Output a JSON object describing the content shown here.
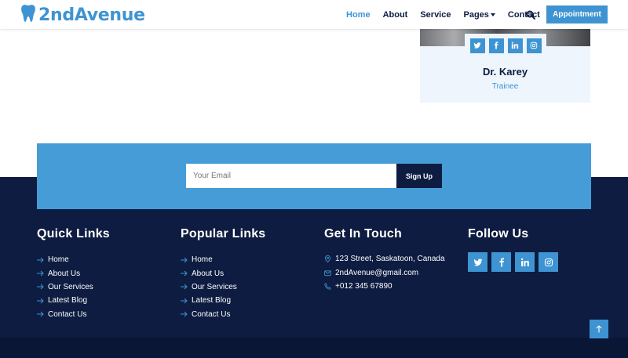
{
  "brand": {
    "name": "2ndAvenue"
  },
  "nav": {
    "items": [
      {
        "label": "Home",
        "active": true
      },
      {
        "label": "About"
      },
      {
        "label": "Service"
      },
      {
        "label": "Pages",
        "dropdown": true
      },
      {
        "label": "Contact"
      }
    ],
    "appointment_label": "Appointment"
  },
  "team_member": {
    "name": "Dr. Karey",
    "role": "Trainee"
  },
  "newsletter": {
    "placeholder": "Your Email",
    "button_label": "Sign Up"
  },
  "footer": {
    "quick_links": {
      "title": "Quick Links",
      "items": [
        "Home",
        "About Us",
        "Our Services",
        "Latest Blog",
        "Contact Us"
      ]
    },
    "popular_links": {
      "title": "Popular Links",
      "items": [
        "Home",
        "About Us",
        "Our Services",
        "Latest Blog",
        "Contact Us"
      ]
    },
    "contact": {
      "title": "Get In Touch",
      "address": "123 Street, Saskatoon, Canada",
      "email": "2ndAvenue@gmail.com",
      "phone": "+012 345 67890"
    },
    "follow": {
      "title": "Follow Us",
      "icons": [
        "twitter-icon",
        "facebook-icon",
        "linkedin-icon",
        "instagram-icon"
      ]
    }
  },
  "colors": {
    "primary": "#3e94d2",
    "dark": "#0d1c40",
    "newsletter_bg": "#459cd6",
    "card_bg": "#eef5fc"
  }
}
